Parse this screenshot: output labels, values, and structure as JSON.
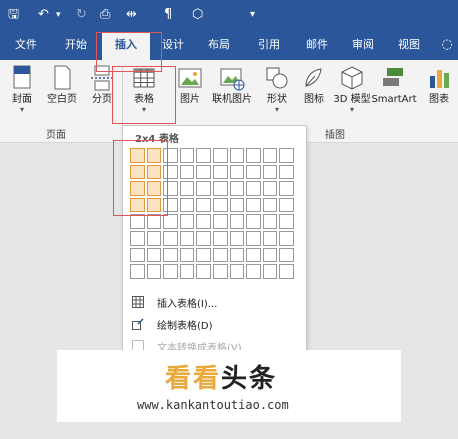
{
  "qat": {
    "icons": [
      "save-icon",
      "undo-icon",
      "dropdown-caret-icon",
      "redo-icon",
      "print-preview-icon",
      "paste-icon",
      "paragraph-icon",
      "shape-outline-icon",
      "customize-icon"
    ],
    "glyphs": [
      "🖫",
      "↶",
      "▾",
      "↻",
      "⎙",
      "⇹",
      "¶",
      "⬡",
      "▾"
    ]
  },
  "tabs": [
    {
      "label": "文件"
    },
    {
      "label": "开始"
    },
    {
      "label": "插入",
      "active": true
    },
    {
      "label": "设计"
    },
    {
      "label": "布局"
    },
    {
      "label": "引用"
    },
    {
      "label": "邮件"
    },
    {
      "label": "审阅"
    },
    {
      "label": "视图"
    }
  ],
  "tell_me_icon": "lightbulb-icon",
  "ribbon": {
    "buttons": [
      {
        "label": "封面",
        "icon": "cover-page-icon",
        "has_caret": true
      },
      {
        "label": "空白页",
        "icon": "blank-page-icon",
        "has_caret": false
      },
      {
        "label": "分页",
        "icon": "page-break-icon",
        "has_caret": false
      },
      {
        "label": "表格",
        "icon": "table-icon",
        "has_caret": true
      },
      {
        "label": "图片",
        "icon": "picture-icon",
        "has_caret": false
      },
      {
        "label": "联机图片",
        "icon": "online-picture-icon",
        "has_caret": false
      },
      {
        "label": "形状",
        "icon": "shapes-icon",
        "has_caret": true
      },
      {
        "label": "图标",
        "icon": "icons-icon",
        "has_caret": false
      },
      {
        "label": "3D 模型",
        "icon": "3d-model-icon",
        "has_caret": true
      },
      {
        "label": "SmartArt",
        "icon": "smartart-icon",
        "has_caret": false
      },
      {
        "label": "图表",
        "icon": "chart-icon",
        "has_caret": false
      }
    ],
    "groups": [
      {
        "label": "页面"
      },
      {
        "label": "插图"
      }
    ]
  },
  "table_dropdown": {
    "title": "2x4 表格",
    "grid_cols": 10,
    "grid_rows": 8,
    "selected_cols": 2,
    "selected_rows": 4,
    "menu_items": [
      {
        "label": "插入表格(I)...",
        "icon": "insert-table-icon",
        "enabled": true
      },
      {
        "label": "绘制表格(D)",
        "icon": "draw-table-icon",
        "enabled": true
      },
      {
        "label": "文本转换成表格(V)...",
        "icon": "convert-text-icon",
        "enabled": false
      }
    ]
  },
  "watermark": {
    "brand_part1": "看看",
    "brand_part2": "头条",
    "url": "www.kankantoutiao.com"
  },
  "colors": {
    "accent": "#2b579a",
    "highlight": "#e05555",
    "selected_cell": "#fbe3c2",
    "brand_orange": "#e8a93a"
  }
}
